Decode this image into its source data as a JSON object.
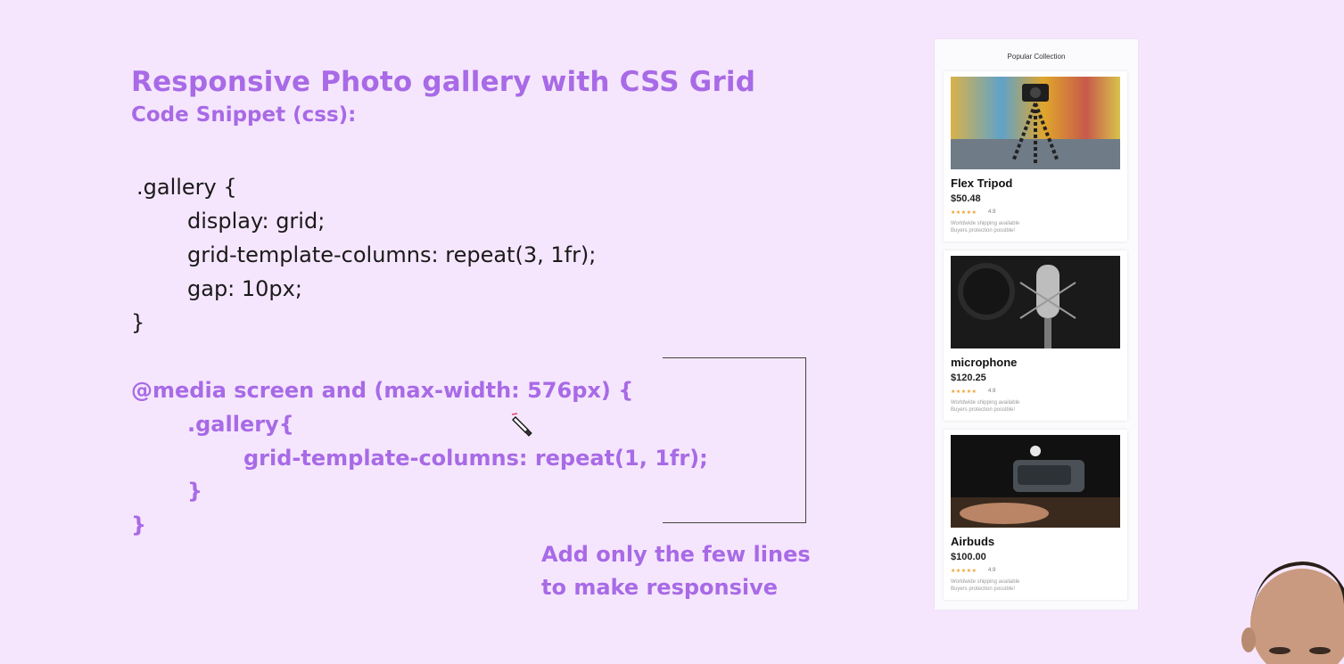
{
  "slide": {
    "title": "Responsive Photo gallery with CSS Grid",
    "subtitle": "Code Snippet (css):",
    "code_lines": [
      ".gallery {",
      "display: grid;",
      "grid-template-columns: repeat(3, 1fr);",
      "gap: 10px;",
      "}"
    ],
    "media_lines": [
      "@media screen and (max-width: 576px) {",
      ".gallery{",
      "grid-template-columns: repeat(1, 1fr);",
      "}",
      "}"
    ],
    "note_line1": "Add only the few lines",
    "note_line2": "to make responsive"
  },
  "phone": {
    "section_title": "Popular Collection",
    "cards": [
      {
        "name": "Flex Tripod",
        "price": "$50.48",
        "stars": "★★★★★",
        "rating": "4.9",
        "desc_line1": "Worldwide shipping available",
        "desc_line2": "Buyers protection possible!"
      },
      {
        "name": "microphone",
        "price": "$120.25",
        "stars": "★★★★★",
        "rating": "4.9",
        "desc_line1": "Worldwide shipping available",
        "desc_line2": "Buyers protection possible!"
      },
      {
        "name": "Airbuds",
        "price": "$100.00",
        "stars": "★★★★★",
        "rating": "4.9",
        "desc_line1": "Worldwide shipping available",
        "desc_line2": "Buyers protection possible!"
      }
    ]
  },
  "colors": {
    "background": "#f5e6fd",
    "accent": "#a86ae6",
    "code_text": "#1a1a1a",
    "star": "#f29f2f"
  }
}
